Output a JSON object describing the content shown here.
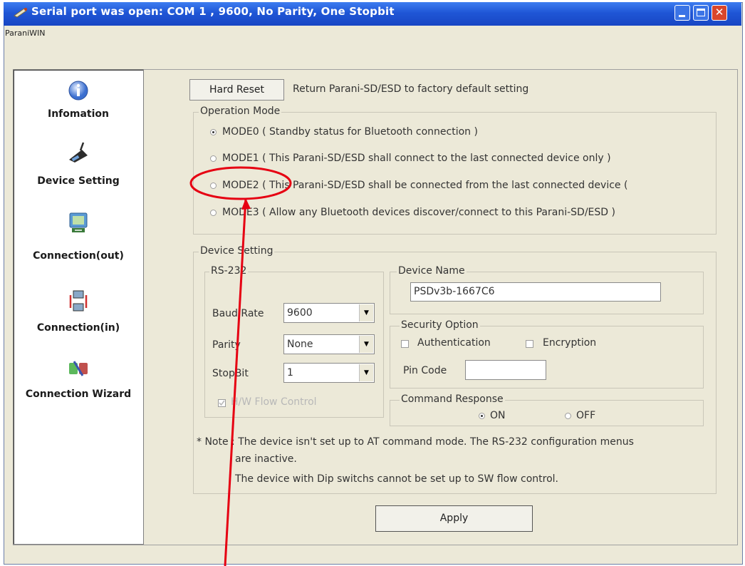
{
  "window": {
    "title": "Serial port was open: COM 1 , 9600, No Parity, One Stopbit",
    "menu_label": "ParaniWIN",
    "close_glyph": "✕"
  },
  "sidebar": {
    "items": [
      {
        "label": "Infomation",
        "icon": "info-icon"
      },
      {
        "label": "Device Setting",
        "icon": "device-icon"
      },
      {
        "label": "Connection(out)",
        "icon": "connection-out-icon"
      },
      {
        "label": "Connection(in)",
        "icon": "connection-in-icon"
      },
      {
        "label": "Connection Wizard",
        "icon": "wizard-icon"
      }
    ]
  },
  "main": {
    "hard_reset_label": "Hard Reset",
    "hard_reset_desc": "Return Parani-SD/ESD to factory default setting",
    "operation_mode": {
      "title": "Operation Mode",
      "options": [
        {
          "label": "MODE0 ( Standby status for Bluetooth connection )",
          "selected": true
        },
        {
          "label": "MODE1 ( This Parani-SD/ESD shall connect to the last connected device only )",
          "selected": false
        },
        {
          "label": "MODE2 ( This Parani-SD/ESD shall be connected from the last connected device (",
          "selected": false
        },
        {
          "label": "MODE3 ( Allow any Bluetooth devices discover/connect to this Parani-SD/ESD )",
          "selected": false
        }
      ]
    },
    "device_setting": {
      "title": "Device Setting",
      "rs232": {
        "title": "RS-232",
        "baud_label": "Baud Rate",
        "baud_value": "9600",
        "parity_label": "Parity",
        "parity_value": "None",
        "stopbit_label": "StopBit",
        "stopbit_value": "1",
        "flow_label": "H/W Flow Control",
        "flow_checked": true
      },
      "device_name": {
        "title": "Device Name",
        "value": "PSDv3b-1667C6"
      },
      "security": {
        "title": "Security Option",
        "auth_label": "Authentication",
        "enc_label": "Encryption",
        "pin_label": "Pin Code",
        "pin_value": ""
      },
      "command_response": {
        "title": "Command Response",
        "on_label": "ON",
        "off_label": "OFF",
        "selected": "ON"
      },
      "note_line1": "* Note : The device isn't set up to AT command mode. The RS-232 configuration menus",
      "note_line2": "are inactive.",
      "note_line3": "The device with Dip switchs cannot be set up to SW flow control."
    },
    "apply_label": "Apply"
  },
  "colors": {
    "titlebar": "#1f56d6",
    "window_bg": "#ece9d8",
    "annotation": "#e60012"
  }
}
